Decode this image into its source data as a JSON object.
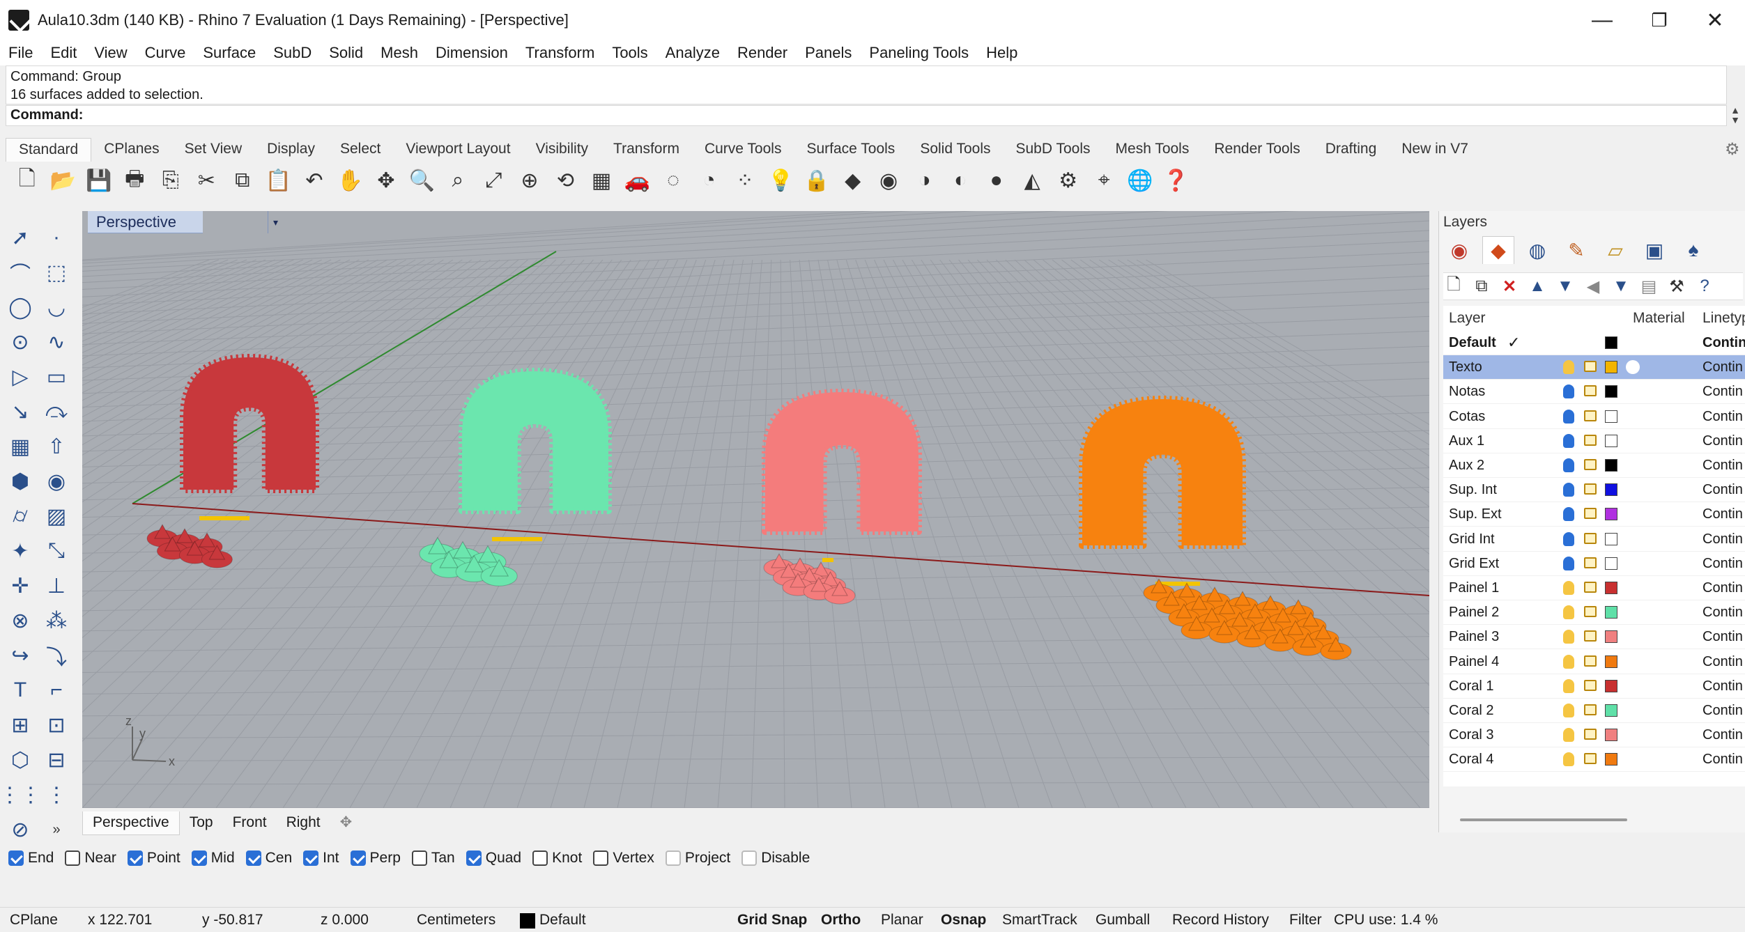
{
  "window": {
    "title": "Aula10.3dm (140 KB) - Rhino 7 Evaluation (1 Days Remaining) - [Perspective]",
    "minimize": "—",
    "restore": "❐",
    "close": "✕"
  },
  "menu": [
    "File",
    "Edit",
    "View",
    "Curve",
    "Surface",
    "SubD",
    "Solid",
    "Mesh",
    "Dimension",
    "Transform",
    "Tools",
    "Analyze",
    "Render",
    "Panels",
    "Paneling Tools",
    "Help"
  ],
  "command": {
    "history_line1": "Command: Group",
    "history_line2": "16 surfaces added to selection.",
    "prompt": "Command:"
  },
  "toolbar_tabs": [
    "Standard",
    "CPlanes",
    "Set View",
    "Display",
    "Select",
    "Viewport Layout",
    "Visibility",
    "Transform",
    "Curve Tools",
    "Surface Tools",
    "Solid Tools",
    "SubD Tools",
    "Mesh Tools",
    "Render Tools",
    "Drafting",
    "New in V7"
  ],
  "standard_tools": [
    "new-file",
    "open-file",
    "save",
    "print",
    "import",
    "cut",
    "copy",
    "paste",
    "undo",
    "pan",
    "move-view",
    "zoom",
    "zoom-window",
    "zoom-extents",
    "zoom-selected",
    "rotate-view",
    "four-viewports",
    "car",
    "hide",
    "show",
    "points",
    "light",
    "lock",
    "layers",
    "color-wheel",
    "shade",
    "rendered",
    "render-sphere",
    "select",
    "options",
    "dimension",
    "earth",
    "help"
  ],
  "left_tools": [
    "select-arrow",
    "point",
    "polyline",
    "curve-from-points",
    "circle",
    "arc",
    "ellipse",
    "freeform-curve",
    "polygon",
    "rectangle",
    "fillet",
    "offset",
    "surface-from-points",
    "extrude",
    "box",
    "boolean",
    "cylinder",
    "mesh",
    "transform",
    "move",
    "gumball",
    "orient",
    "join",
    "explode",
    "trim",
    "split",
    "text",
    "dimension",
    "group",
    "array",
    "analyze",
    "render",
    "grid",
    "spacing",
    "cage",
    "more"
  ],
  "viewport": {
    "label": "Perspective",
    "dropdown": "▾",
    "axis_x": "x",
    "axis_y": "y",
    "axis_z": "z"
  },
  "viewport_tabs": [
    "Perspective",
    "Top",
    "Front",
    "Right"
  ],
  "viewport_add": "✥",
  "osnap": [
    {
      "label": "End",
      "checked": true
    },
    {
      "label": "Near",
      "checked": false
    },
    {
      "label": "Point",
      "checked": true
    },
    {
      "label": "Mid",
      "checked": true
    },
    {
      "label": "Cen",
      "checked": true
    },
    {
      "label": "Int",
      "checked": true
    },
    {
      "label": "Perp",
      "checked": true
    },
    {
      "label": "Tan",
      "checked": false
    },
    {
      "label": "Quad",
      "checked": true
    },
    {
      "label": "Knot",
      "checked": false
    },
    {
      "label": "Vertex",
      "checked": false
    },
    {
      "label": "Project",
      "checked": false
    },
    {
      "label": "Disable",
      "checked": false
    }
  ],
  "status": {
    "cplane": "CPlane",
    "x": "x 122.701",
    "y": "y -50.817",
    "z": "z 0.000",
    "units": "Centimeters",
    "layer": "Default",
    "grid_snap": "Grid Snap",
    "ortho": "Ortho",
    "planar": "Planar",
    "osnap": "Osnap",
    "smarttrack": "SmartTrack",
    "gumball": "Gumball",
    "record_history": "Record History",
    "filter": "Filter",
    "cpu": "CPU use: 1.4 %"
  },
  "layers_panel": {
    "title": "Layers",
    "col_layer": "Layer",
    "col_material": "Material",
    "col_linetype": "Linetyp",
    "rows": [
      {
        "name": "Default",
        "current": true,
        "color": "#000000",
        "linetype": "Contin",
        "bulb": false
      },
      {
        "name": "Texto",
        "selected": true,
        "color": "#f3b400",
        "linetype": "Contin",
        "bulb": "#f5c542",
        "material": true
      },
      {
        "name": "Notas",
        "color": "#000000",
        "linetype": "Contin",
        "bulb": "#2a6fd6"
      },
      {
        "name": "Cotas",
        "color": "#ffffff",
        "linetype": "Contin",
        "bulb": "#2a6fd6"
      },
      {
        "name": "Aux 1",
        "color": "#ffffff",
        "linetype": "Contin",
        "bulb": "#2a6fd6"
      },
      {
        "name": "Aux 2",
        "color": "#000000",
        "linetype": "Contin",
        "bulb": "#2a6fd6"
      },
      {
        "name": "Sup. Int",
        "color": "#1010e0",
        "linetype": "Contin",
        "bulb": "#2a6fd6"
      },
      {
        "name": "Sup. Ext",
        "color": "#b030e0",
        "linetype": "Contin",
        "bulb": "#2a6fd6"
      },
      {
        "name": "Grid Int",
        "color": "#ffffff",
        "linetype": "Contin",
        "bulb": "#2a6fd6"
      },
      {
        "name": "Grid Ext",
        "color": "#ffffff",
        "linetype": "Contin",
        "bulb": "#2a6fd6"
      },
      {
        "name": "Painel 1",
        "color": "#c83030",
        "linetype": "Contin",
        "bulb": "#f5c542"
      },
      {
        "name": "Painel 2",
        "color": "#5fe0a8",
        "linetype": "Contin",
        "bulb": "#f5c542"
      },
      {
        "name": "Painel 3",
        "color": "#f08080",
        "linetype": "Contin",
        "bulb": "#f5c542"
      },
      {
        "name": "Painel 4",
        "color": "#f07a10",
        "linetype": "Contin",
        "bulb": "#f5c542"
      },
      {
        "name": "Coral 1",
        "color": "#c83030",
        "linetype": "Contin",
        "bulb": "#f5c542"
      },
      {
        "name": "Coral 2",
        "color": "#5fe0a8",
        "linetype": "Contin",
        "bulb": "#f5c542"
      },
      {
        "name": "Coral 3",
        "color": "#f08080",
        "linetype": "Contin",
        "bulb": "#f5c542"
      },
      {
        "name": "Coral 4",
        "color": "#f07a10",
        "linetype": "Contin",
        "bulb": "#f5c542"
      }
    ]
  },
  "colors": {
    "coral1": "#c8383c",
    "coral2": "#6be6ae",
    "coral3": "#f47c7c",
    "coral4": "#f7820f",
    "grid_bg": "#a7abb1",
    "x_axis": "#8b1a1a",
    "y_axis": "#2f8a2f"
  }
}
